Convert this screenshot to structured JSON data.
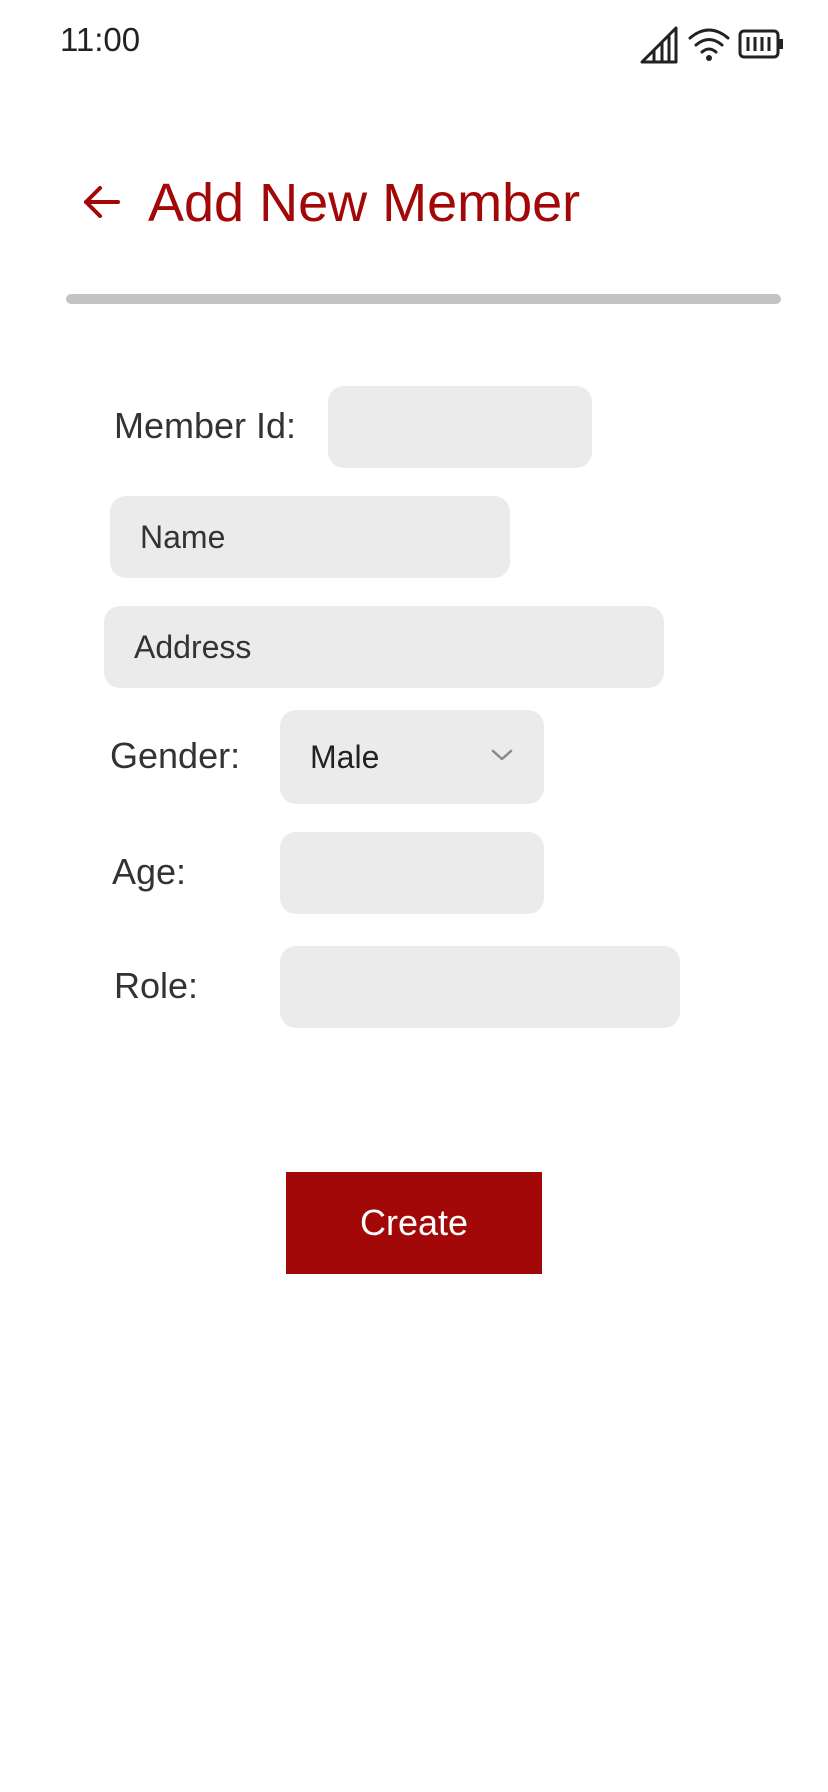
{
  "status_bar": {
    "time": "11:00",
    "icons": [
      "signal-icon",
      "wifi-icon",
      "battery-icon"
    ]
  },
  "header": {
    "back_icon": "arrow-left-icon",
    "title": "Add New Member"
  },
  "form": {
    "member_id": {
      "label": "Member Id:",
      "value": ""
    },
    "name": {
      "placeholder": "Name",
      "value": ""
    },
    "address": {
      "placeholder": "Address",
      "value": ""
    },
    "gender": {
      "label": "Gender:",
      "selected": "Male"
    },
    "age": {
      "label": "Age:",
      "value": ""
    },
    "role": {
      "label": "Role:",
      "value": ""
    }
  },
  "actions": {
    "create_label": "Create"
  },
  "colors": {
    "accent": "#a30808",
    "field_bg": "#ebebeb",
    "divider": "#c3c3c3"
  }
}
